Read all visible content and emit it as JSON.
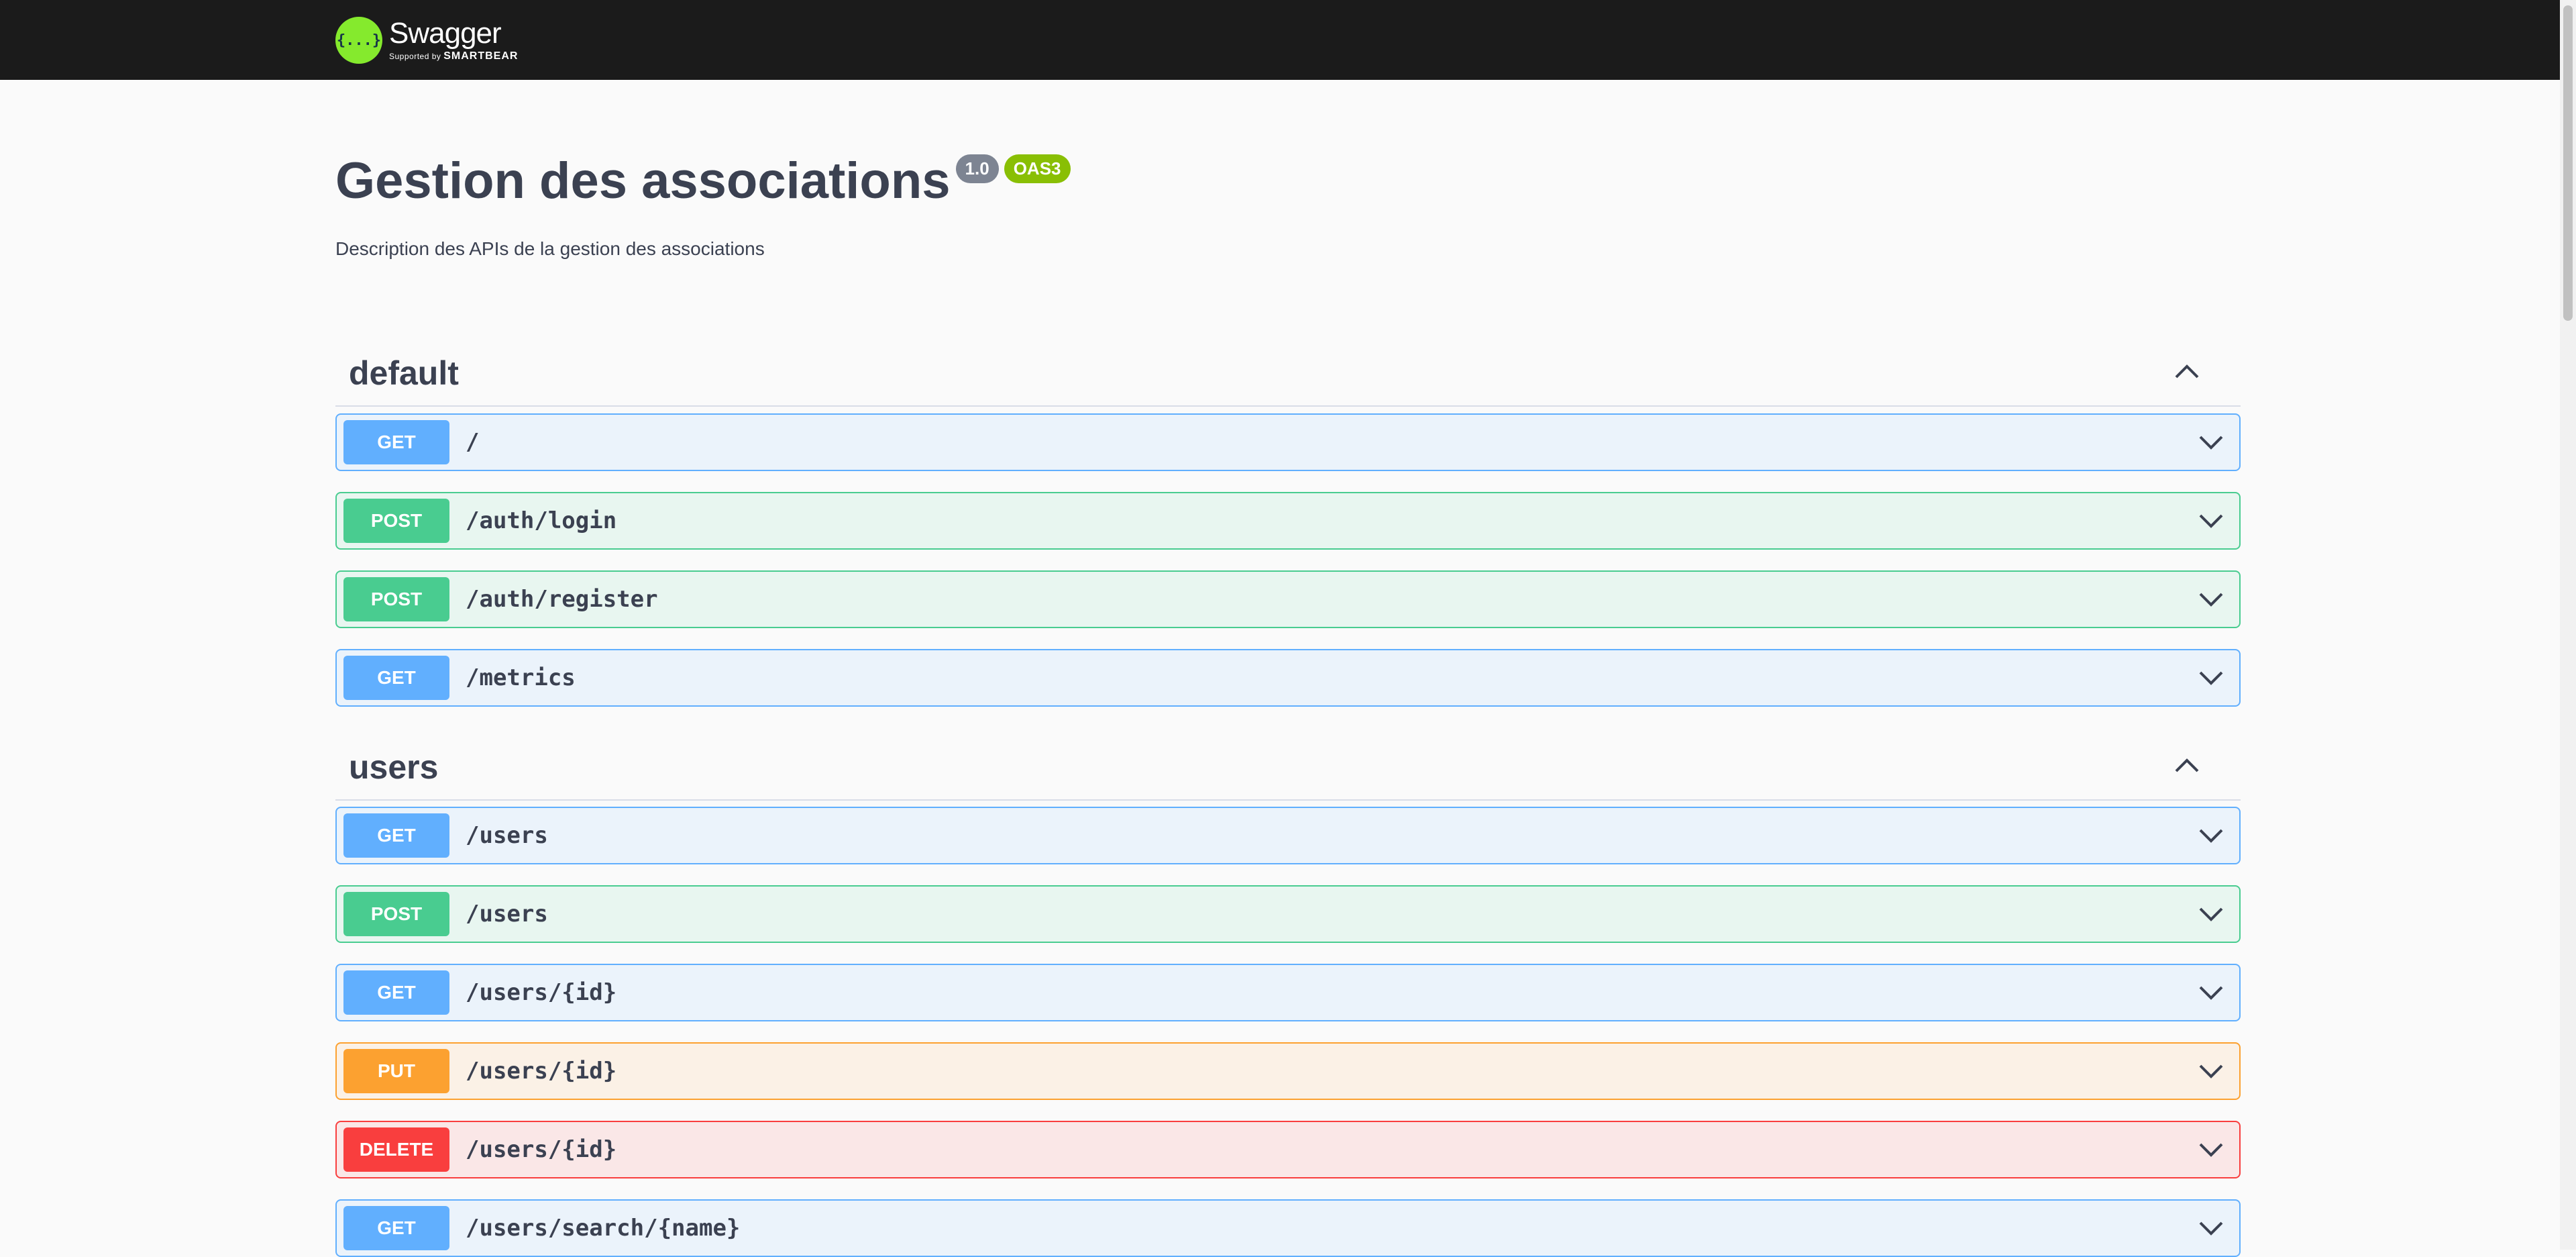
{
  "topbar": {
    "logo_name": "Swagger",
    "logo_sub_prefix": "Supported by",
    "logo_sub_brand": "SMARTBEAR",
    "logo_mark": "{...}"
  },
  "info": {
    "title": "Gestion des associations",
    "version": "1.0",
    "oas": "OAS3",
    "description": "Description des APIs de la gestion des associations"
  },
  "sections": [
    {
      "name": "default",
      "ops": [
        {
          "method": "GET",
          "path": "/"
        },
        {
          "method": "POST",
          "path": "/auth/login"
        },
        {
          "method": "POST",
          "path": "/auth/register"
        },
        {
          "method": "GET",
          "path": "/metrics"
        }
      ]
    },
    {
      "name": "users",
      "ops": [
        {
          "method": "GET",
          "path": "/users"
        },
        {
          "method": "POST",
          "path": "/users"
        },
        {
          "method": "GET",
          "path": "/users/{id}"
        },
        {
          "method": "PUT",
          "path": "/users/{id}"
        },
        {
          "method": "DELETE",
          "path": "/users/{id}"
        },
        {
          "method": "GET",
          "path": "/users/search/{name}"
        }
      ]
    }
  ],
  "colors": {
    "get": "#61affe",
    "post": "#49cc90",
    "put": "#fca130",
    "delete": "#f93e3e",
    "logo": "#85ea2d"
  },
  "icons": {
    "section_toggle": "chevron-up-icon",
    "operation_toggle": "chevron-down-icon"
  }
}
